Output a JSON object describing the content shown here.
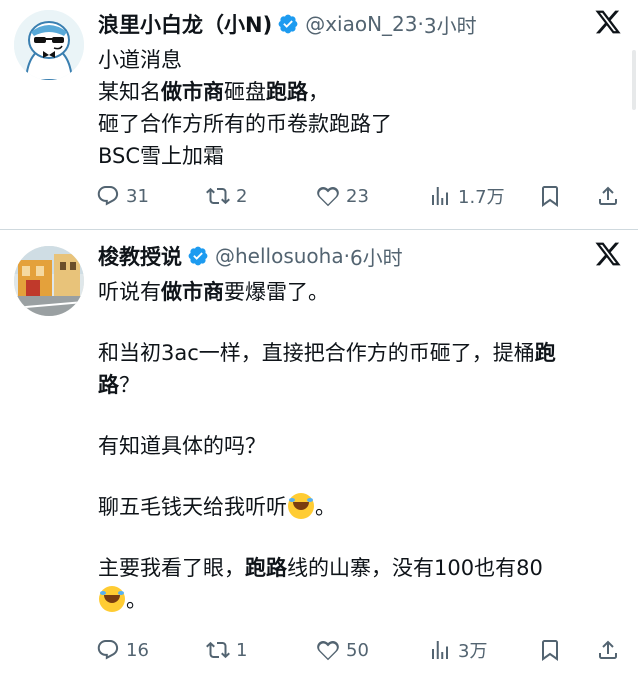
{
  "tweets": [
    {
      "name": "浪里小白龙（小N)",
      "handle": "@xiaoN_23",
      "dot": "·",
      "time": "3小时",
      "lines": [
        [
          {
            "t": "小道消息",
            "b": false
          }
        ],
        [
          {
            "t": "某知名",
            "b": false
          },
          {
            "t": "做市商",
            "b": true
          },
          {
            "t": "砸盘",
            "b": false
          },
          {
            "t": "跑路",
            "b": true
          },
          {
            "t": "，",
            "b": false
          }
        ],
        [
          {
            "t": "砸了合作方所有的币卷款跑路了",
            "b": false
          }
        ],
        [
          {
            "t": "BSC雪上加霜",
            "b": false
          }
        ]
      ],
      "actions": {
        "replies": "31",
        "retweets": "2",
        "likes": "23",
        "views": "1.7万"
      }
    },
    {
      "name": "梭教授说",
      "handle": "@hellosuoha",
      "dot": "·",
      "time": "6小时",
      "lines": [
        [
          {
            "t": "听说有",
            "b": false
          },
          {
            "t": "做市商",
            "b": true
          },
          {
            "t": "要爆雷了。",
            "b": false
          }
        ],
        [],
        [
          {
            "t": "和当初3ac一样，直接把合作方的币砸了，提桶",
            "b": false
          },
          {
            "t": "跑",
            "b": true
          }
        ],
        [
          {
            "t": "路",
            "b": true
          },
          {
            "t": "？",
            "b": false
          }
        ],
        [],
        [
          {
            "t": "有知道具体的吗？",
            "b": false
          }
        ],
        [],
        [
          {
            "t": "聊五毛钱天给我听听",
            "b": false
          },
          {
            "emoji": "rolling-laughing-emoji"
          },
          {
            "t": "。",
            "b": false
          }
        ],
        [],
        [
          {
            "t": "主要我看了眼，",
            "b": false
          },
          {
            "t": "跑路",
            "b": true
          },
          {
            "t": "线的山寨，没有100也有80",
            "b": false
          }
        ],
        [
          {
            "emoji": "rolling-laughing-emoji"
          },
          {
            "t": "。",
            "b": false
          }
        ]
      ],
      "actions": {
        "replies": "16",
        "retweets": "1",
        "likes": "50",
        "views": "3万"
      }
    }
  ],
  "colors": {
    "verified": "#1d9bf0",
    "text": "#0f1419",
    "secondary": "#536471",
    "divider": "#cfd9de"
  },
  "icons": [
    "reply-icon",
    "retweet-icon",
    "like-icon",
    "views-icon",
    "bookmark-icon",
    "share-icon",
    "x-logo-icon",
    "verified-badge-icon"
  ]
}
